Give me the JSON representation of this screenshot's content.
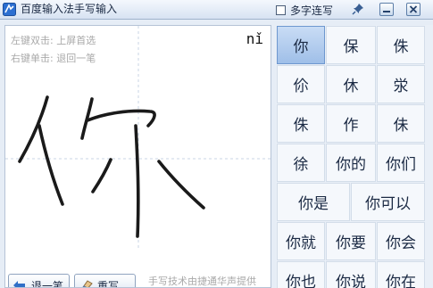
{
  "titlebar": {
    "title": "百度输入法手写输入",
    "multi_label": "多字连写",
    "multi_checked": false,
    "icons": [
      "app-icon",
      "pin-icon",
      "minimize-icon",
      "close-icon"
    ]
  },
  "canvas": {
    "hint_line1": "左键双击: 上屏首选",
    "hint_line2": "右键单击: 退回一笔",
    "pinyin": "nǐ",
    "ink_color": "#1a1a1a"
  },
  "bottom": {
    "undo_label": "退一笔",
    "rewrite_label": "重写",
    "credit": "手写技术由捷通华声提供"
  },
  "candidates": {
    "row1": [
      "你",
      "保",
      "侏"
    ],
    "row2": [
      "伱",
      "休",
      "泶"
    ],
    "row3": [
      "侏",
      "作",
      "佅"
    ],
    "row4": [
      "徐",
      "你的",
      "你们"
    ],
    "row5": [
      "你是",
      "你可以"
    ],
    "row6": [
      "你就",
      "你要",
      "你会"
    ],
    "row7": [
      "你也",
      "你说",
      "你在"
    ],
    "selected": "你"
  },
  "colors": {
    "accent": "#9fbfe8",
    "titlebar": "#d7e3f2"
  }
}
